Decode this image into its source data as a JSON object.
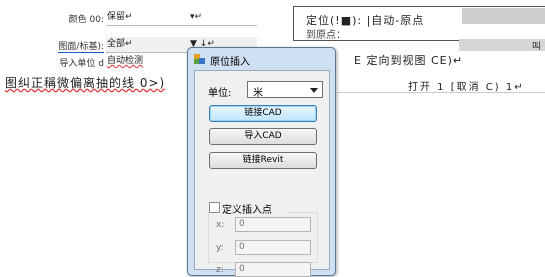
{
  "background": {
    "rows": [
      {
        "label": "颜色 00:",
        "value": "保留↵",
        "extra": "▾↵"
      },
      {
        "label": "图面/标基):",
        "value": "全部↵",
        "extra": "▼ ↓↵"
      },
      {
        "label": "导入单位 d",
        "value": "自动检测",
        "extra": ""
      }
    ],
    "top_right_text": "定位(!■): |自动-原点",
    "top_right_subtext": "到原点：",
    "mid_right_text": "叫",
    "command_line": "图纠正稱微偏离抽的线 0>)",
    "view_link": "E 定向到视图 CE)↵",
    "buttons_row": "打开 1 [取消 C) 1↵"
  },
  "dialog": {
    "title": "原位插入",
    "unit_label": "单位:",
    "unit_value": "米",
    "buttons": {
      "link_cad": "链接CAD",
      "import_cad": "导入CAD",
      "link_revit": "链接Revit"
    },
    "custom_point_label": "定义插入点",
    "custom_point_checked": false,
    "coords": [
      {
        "label": "x:",
        "value": "0"
      },
      {
        "label": "y:",
        "value": "0"
      },
      {
        "label": "z:",
        "value": "0"
      }
    ]
  },
  "colors": {
    "dialog_frame": "#cfe0f2",
    "client_bg": "#f0f0f0",
    "default_button": "#bee6fd"
  }
}
